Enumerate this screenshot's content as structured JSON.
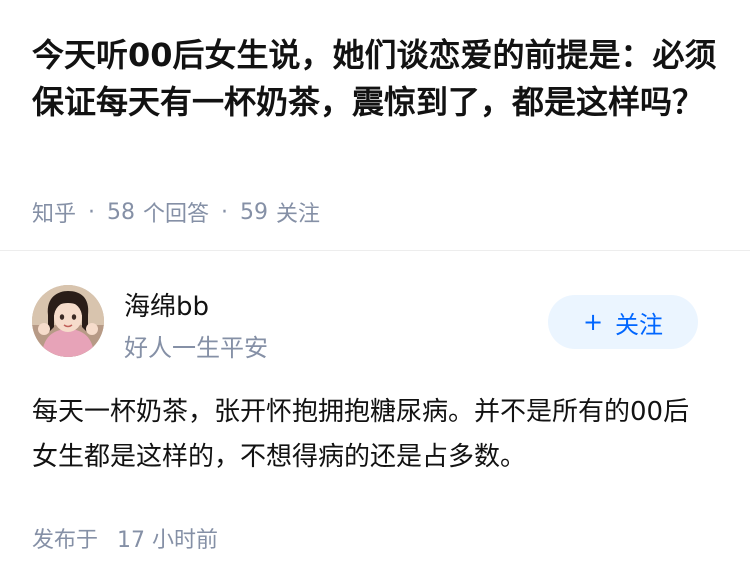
{
  "question": {
    "title": "今天听00后女生说，她们谈恋爱的前提是：必须保证每天有一杯奶茶，震惊到了，都是这样吗？",
    "source": "知乎",
    "separator": "·",
    "answers_count": "58",
    "answers_label": "个回答",
    "followers_count": "59",
    "followers_label": "关注"
  },
  "author": {
    "name": "海绵bb",
    "bio": "好人一生平安",
    "follow_plus": "+",
    "follow_label": "关注"
  },
  "answer": {
    "content": "每天一杯奶茶，张开怀抱拥抱糖尿病。并不是所有的00后女生都是这样的，不想得病的还是占多数。",
    "time_label": "发布于",
    "time_value": "17 小时前"
  },
  "colors": {
    "accent": "#0066ff",
    "follow_bg": "#ebf5ff",
    "meta_gray": "#8590a6",
    "text": "#121212"
  }
}
